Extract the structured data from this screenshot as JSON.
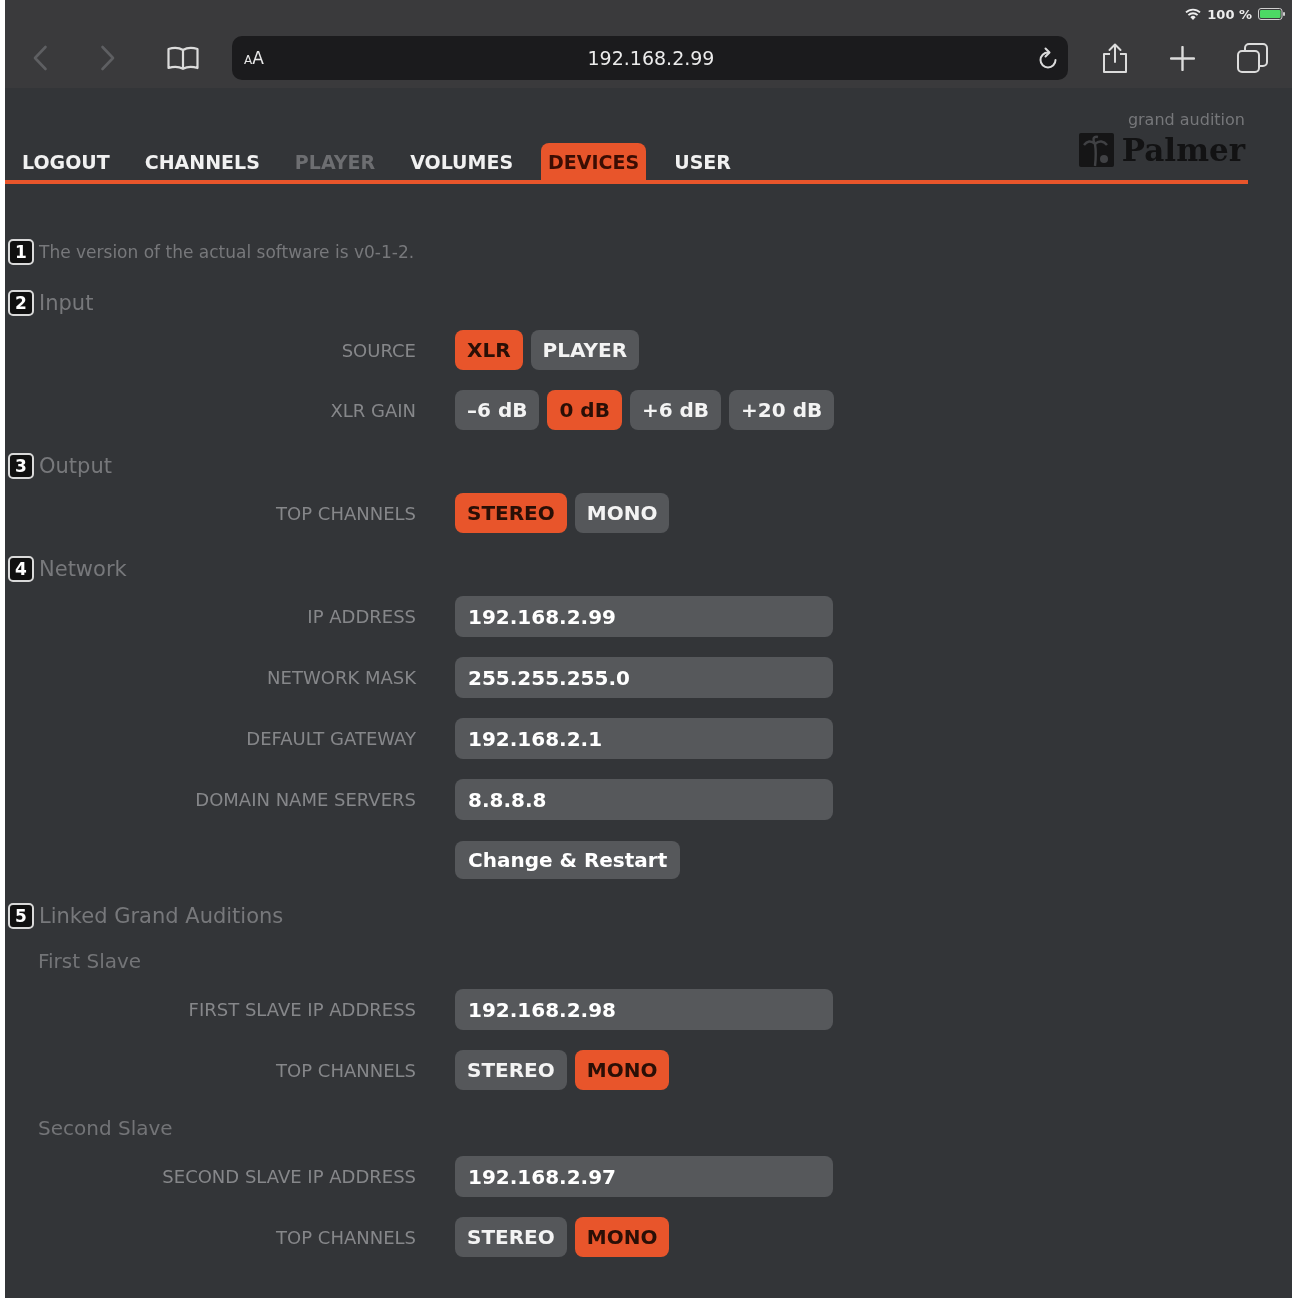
{
  "status_bar": {
    "battery_percent": "100 %"
  },
  "browser": {
    "text_size_button": "AA",
    "address": "192.168.2.99"
  },
  "nav": {
    "tabs": [
      {
        "label": "LOGOUT",
        "selected": false,
        "disabled": false
      },
      {
        "label": "CHANNELS",
        "selected": false,
        "disabled": false
      },
      {
        "label": "PLAYER",
        "selected": false,
        "disabled": true
      },
      {
        "label": "VOLUMES",
        "selected": false,
        "disabled": false
      },
      {
        "label": "DEVICES",
        "selected": true,
        "disabled": false
      },
      {
        "label": "USER",
        "selected": false,
        "disabled": false
      }
    ],
    "logo": {
      "tagline": "grand audition",
      "name": "Palmer"
    }
  },
  "sections": [
    {
      "kind": "note",
      "number": "1",
      "title": "The version of the actual software is v0-1-2."
    },
    {
      "kind": "heading",
      "number": "2",
      "title": "Input",
      "rows": [
        {
          "kind": "choice",
          "label": "SOURCE",
          "options": [
            {
              "label": "XLR",
              "selected": true
            },
            {
              "label": "PLAYER",
              "selected": false
            }
          ]
        },
        {
          "kind": "choice",
          "label": "XLR GAIN",
          "options": [
            {
              "label": "–6 dB",
              "selected": false
            },
            {
              "label": "0 dB",
              "selected": true
            },
            {
              "label": "+6 dB",
              "selected": false
            },
            {
              "label": "+20 dB",
              "selected": false
            }
          ]
        }
      ]
    },
    {
      "kind": "heading",
      "number": "3",
      "title": "Output",
      "rows": [
        {
          "kind": "choice",
          "label": "TOP CHANNELS",
          "options": [
            {
              "label": "STEREO",
              "selected": true
            },
            {
              "label": "MONO",
              "selected": false
            }
          ]
        }
      ]
    },
    {
      "kind": "heading",
      "number": "4",
      "title": "Network",
      "rows": [
        {
          "kind": "field",
          "label": "IP ADDRESS",
          "value": "192.168.2.99"
        },
        {
          "kind": "field",
          "label": "NETWORK MASK",
          "value": "255.255.255.0"
        },
        {
          "kind": "field",
          "label": "DEFAULT GATEWAY",
          "value": "192.168.2.1"
        },
        {
          "kind": "field",
          "label": "DOMAIN NAME SERVERS",
          "value": "8.8.8.8"
        },
        {
          "kind": "button",
          "label": "Change & Restart"
        }
      ]
    },
    {
      "kind": "heading",
      "number": "5",
      "title": "Linked Grand Auditions",
      "rows": [
        {
          "kind": "subheading",
          "label": "First Slave"
        },
        {
          "kind": "field",
          "label": "FIRST SLAVE IP ADDRESS",
          "value": "192.168.2.98"
        },
        {
          "kind": "choice",
          "label": "TOP CHANNELS",
          "options": [
            {
              "label": "STEREO",
              "selected": false
            },
            {
              "label": "MONO",
              "selected": true
            }
          ]
        },
        {
          "kind": "subheading",
          "label": "Second Slave"
        },
        {
          "kind": "field",
          "label": "SECOND SLAVE IP ADDRESS",
          "value": "192.168.2.97"
        },
        {
          "kind": "choice",
          "label": "TOP CHANNELS",
          "options": [
            {
              "label": "STEREO",
              "selected": false
            },
            {
              "label": "MONO",
              "selected": true
            }
          ]
        }
      ]
    }
  ]
}
